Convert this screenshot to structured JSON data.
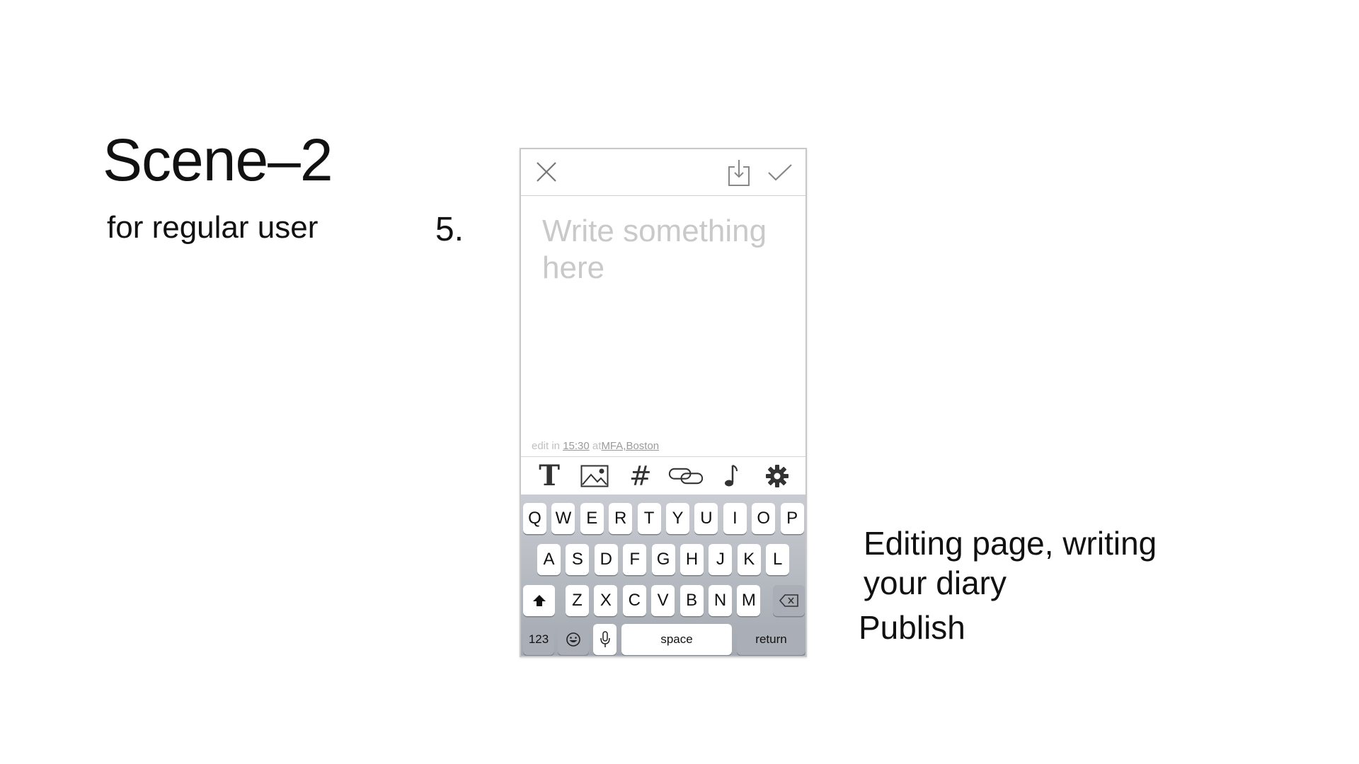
{
  "slide": {
    "title": "Scene–2",
    "subtitle": "for regular user",
    "step_number": "5.",
    "caption": "Editing page, writing your diary",
    "caption_action": "Publish"
  },
  "phone": {
    "editor": {
      "placeholder": "Write something here",
      "meta_prefix": "edit in",
      "meta_time": "15:30",
      "meta_at": "at",
      "meta_location": "MFA,Boston"
    },
    "toolbar_icons": [
      "text-format-icon",
      "image-icon",
      "hashtag-icon",
      "link-icon",
      "music-note-icon",
      "settings-gear-icon"
    ],
    "keyboard": {
      "row1": [
        "Q",
        "W",
        "E",
        "R",
        "T",
        "Y",
        "U",
        "I",
        "O",
        "P"
      ],
      "row2": [
        "A",
        "S",
        "D",
        "F",
        "G",
        "H",
        "J",
        "K",
        "L"
      ],
      "row3": [
        "Z",
        "X",
        "C",
        "V",
        "B",
        "N",
        "M"
      ],
      "numbers_label": "123",
      "space_label": "space",
      "return_label": "return"
    }
  }
}
